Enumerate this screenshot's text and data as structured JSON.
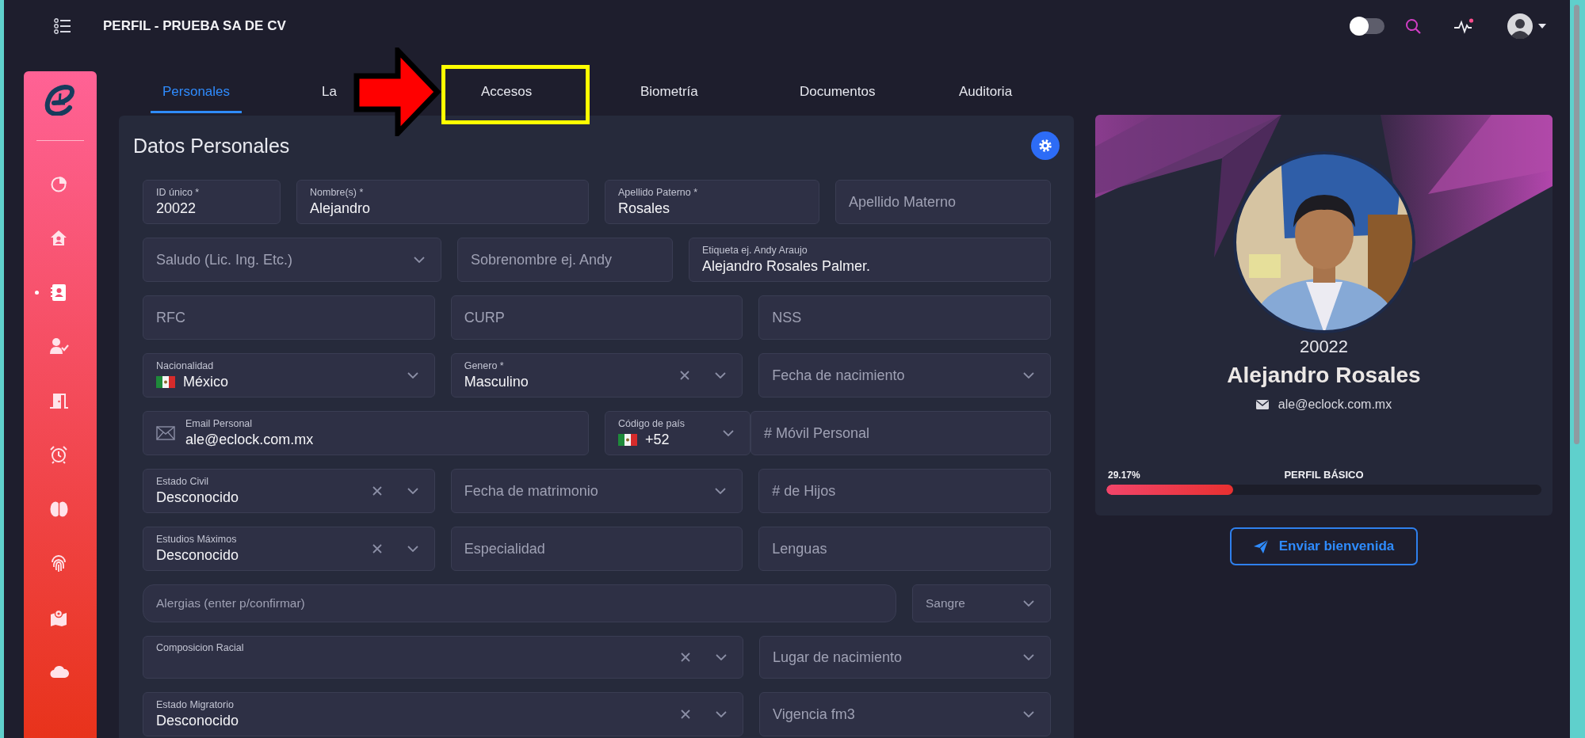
{
  "app_bar": {
    "title": "PERFIL - PRUEBA SA DE CV",
    "theme_toggle": {
      "on": false
    }
  },
  "sidebar": {
    "items": [
      {
        "selected": false
      },
      {
        "selected": false
      },
      {
        "selected": true
      },
      {
        "selected": false
      },
      {
        "selected": false
      },
      {
        "selected": false
      },
      {
        "selected": false
      },
      {
        "selected": false
      },
      {
        "selected": false
      },
      {
        "selected": false
      }
    ]
  },
  "tabs": [
    {
      "label": "Personales",
      "selected": true
    },
    {
      "label": "La",
      "selected": false
    },
    {
      "label": "Accesos",
      "selected": false
    },
    {
      "label": "Biometría",
      "selected": false
    },
    {
      "label": "Documentos",
      "selected": false
    },
    {
      "label": "Auditoria",
      "selected": false
    }
  ],
  "personal_data": {
    "title": "Datos Personales",
    "fields": [
      {
        "kind": "input",
        "label": "ID único *",
        "value": "20022"
      },
      {
        "kind": "input",
        "label": "Nombre(s) *",
        "value": "Alejandro"
      },
      {
        "kind": "input",
        "label": "Apellido Paterno *",
        "value": "Rosales"
      },
      {
        "kind": "input",
        "placeholder": "Apellido Materno"
      },
      {
        "kind": "select",
        "placeholder": "Saludo (Lic. Ing. Etc.)",
        "clearable": false,
        "flag": false
      },
      {
        "kind": "input",
        "placeholder": "Sobrenombre ej. Andy"
      },
      {
        "kind": "input",
        "label": "Etiqueta ej. Andy Araujo",
        "value": "Alejandro Rosales Palmer."
      },
      {
        "kind": "input",
        "placeholder": "RFC"
      },
      {
        "kind": "input",
        "placeholder": "CURP"
      },
      {
        "kind": "input",
        "placeholder": "NSS"
      },
      {
        "kind": "select",
        "label": "Nacionalidad",
        "value": "México",
        "clearable": false,
        "flag": true
      },
      {
        "kind": "select",
        "label": "Genero *",
        "value": "Masculino",
        "clearable": true,
        "flag": false
      },
      {
        "kind": "select",
        "placeholder": "Fecha de nacimiento",
        "clearable": false,
        "flag": false
      },
      {
        "kind": "email",
        "label": "Email Personal",
        "value": "ale@eclock.com.mx"
      },
      {
        "kind": "select",
        "label": "Código de país",
        "value": "+52",
        "clearable": false,
        "flag": true
      },
      {
        "kind": "input",
        "placeholder": "# Móvil Personal"
      },
      {
        "kind": "select",
        "label": "Estado Civil",
        "value": "Desconocido",
        "clearable": true,
        "flag": false
      },
      {
        "kind": "select",
        "placeholder": "Fecha de matrimonio",
        "clearable": false,
        "flag": false
      },
      {
        "kind": "input",
        "placeholder": "# de Hijos"
      },
      {
        "kind": "select",
        "label": "Estudios Máximos",
        "value": "Desconocido",
        "clearable": true,
        "flag": false
      },
      {
        "kind": "input",
        "placeholder": "Especialidad"
      },
      {
        "kind": "input",
        "placeholder": "Lenguas"
      },
      {
        "kind": "tags",
        "placeholder": "Alergias (enter p/confirmar)"
      },
      {
        "kind": "select",
        "placeholder": "Sangre",
        "clearable": false,
        "flag": false
      },
      {
        "kind": "select",
        "label": "Composicion Racial",
        "clearable": true,
        "flag": false
      },
      {
        "kind": "select",
        "placeholder": "Lugar de nacimiento",
        "clearable": false,
        "flag": false
      },
      {
        "kind": "select",
        "label": "Estado Migratorio",
        "value": "Desconocido",
        "clearable": true,
        "flag": false
      },
      {
        "kind": "select",
        "placeholder": "Vigencia fm3",
        "clearable": false,
        "flag": false
      }
    ]
  },
  "profile": {
    "employee_id": "20022",
    "name": "Alejandro Rosales",
    "email": "ale@eclock.com.mx",
    "progress": {
      "reading": "29.17%",
      "title": "PERFIL BÁSICO",
      "level": 0.2917
    },
    "send_button": "Enviar bienvenida"
  }
}
